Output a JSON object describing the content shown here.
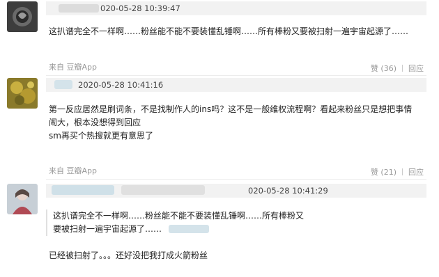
{
  "comments": [
    {
      "timestamp": "020-05-28 10:39:47",
      "text": "这扒谱完全不一样啊……粉丝能不能不要装懂乱锤啊……所有棒粉又要被扫射一遍宇宙起源了……",
      "source": "来自 豆瓣App",
      "likes": "赞 (36)",
      "reply": "回应"
    },
    {
      "timestamp": "2020-05-28 10:41:16",
      "lines": [
        "第一反应居然是刷词条，不是找制作人的ins吗？这不是一般维权流程啊？看起来粉丝只是想把事情",
        "闹大，根本没想得到回应",
        "sm再买个热搜就更有意思了"
      ],
      "source": "来自 豆瓣App",
      "likes": "赞 (21)",
      "reply": "回应"
    },
    {
      "timestamp": "020-05-28 10:41:29",
      "quote_lines": [
        "这扒谱完全不一样啊……粉丝能不能不要装懂乱锤啊……所有棒粉又",
        "要被扫射一遍宇宙起源了……"
      ],
      "text": "已经被扫射了。。。还好没把我打成火箭粉丝"
    }
  ],
  "colors": {
    "header_bar": "#f2f2f2",
    "meta_text": "#999999",
    "body_text": "#222222"
  }
}
